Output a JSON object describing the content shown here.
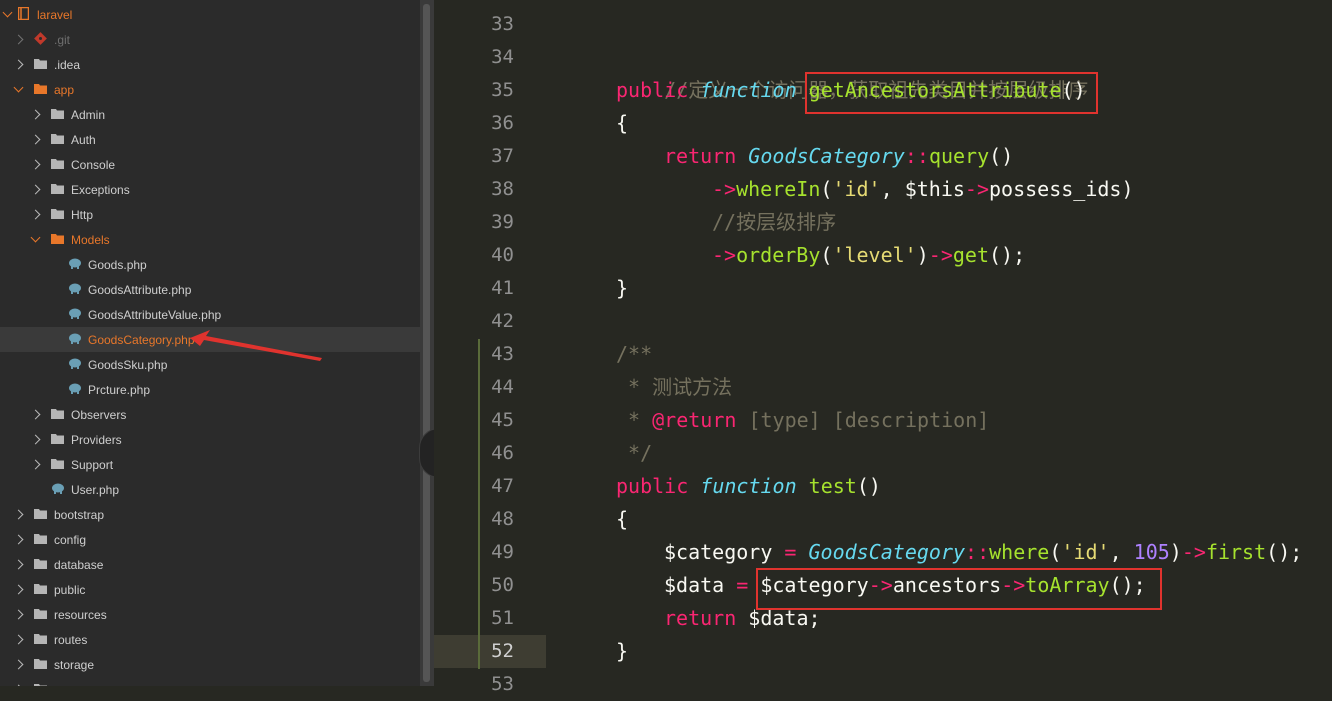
{
  "sidebar": {
    "root": "laravel",
    "git": ".git",
    "idea": ".idea",
    "app": "app",
    "admin": "Admin",
    "auth": "Auth",
    "console": "Console",
    "exceptions": "Exceptions",
    "http": "Http",
    "models": "Models",
    "goods": "Goods.php",
    "goods_attribute": "GoodsAttribute.php",
    "goods_attribute_value": "GoodsAttributeValue.php",
    "goods_category": "GoodsCategory.php",
    "goods_sku": "GoodsSku.php",
    "prcture": "Prcture.php",
    "observers": "Observers",
    "providers": "Providers",
    "support": "Support",
    "user": "User.php",
    "bootstrap": "bootstrap",
    "config": "config",
    "database": "database",
    "public": "public",
    "resources": "resources",
    "routes": "routes",
    "storage": "storage"
  },
  "editor": {
    "line_numbers": [
      "33",
      "34",
      "35",
      "36",
      "37",
      "38",
      "39",
      "40",
      "41",
      "42",
      "43",
      "44",
      "45",
      "46",
      "47",
      "48",
      "49",
      "50",
      "51",
      "52",
      "53"
    ],
    "t": {
      "c34": "//定义一个访问器，获取祖先类目并按层级排序",
      "public": "public",
      "function": "function",
      "getAncestorsAttribute": "getAncestorsAttribute",
      "parens": "()",
      "lbrace": "{",
      "rbrace": "}",
      "return": "return",
      "GoodsCategory": "GoodsCategory",
      "dcolon": "::",
      "query": "query",
      "arrow": "->",
      "whereIn": "whereIn",
      "lparen": "(",
      "str_id": "'id'",
      "comma_sp": ", ",
      "this": "$this",
      "possess_ids": "possess_ids)",
      "c39": "//按层级排序",
      "orderBy": "orderBy",
      "str_level": "'level'",
      "rparen": ")",
      "get": "get",
      "end_call": "();",
      "doc_open": "/**",
      "doc_line44": " * 测试方法",
      "doc_star": " * ",
      "doc_return_tag": "@return",
      "doc_return_rest": " [type] [description]",
      "doc_close": " */",
      "test": "test",
      "var_category": "$category",
      "assign": " = ",
      "where": "where",
      "num_105": "105",
      "first": "first",
      "var_data": "$data",
      "ancestors": "ancestors",
      "toArray": "toArray",
      "return_data": " $data;"
    }
  },
  "colors": {
    "keyword": "#f92672",
    "function_name": "#a6e22e",
    "class_name": "#66d9ef",
    "string": "#e6db74",
    "number": "#ae81ff",
    "comment": "#75715e",
    "highlight_box": "#e0332e",
    "folder_open": "#e8772a"
  }
}
